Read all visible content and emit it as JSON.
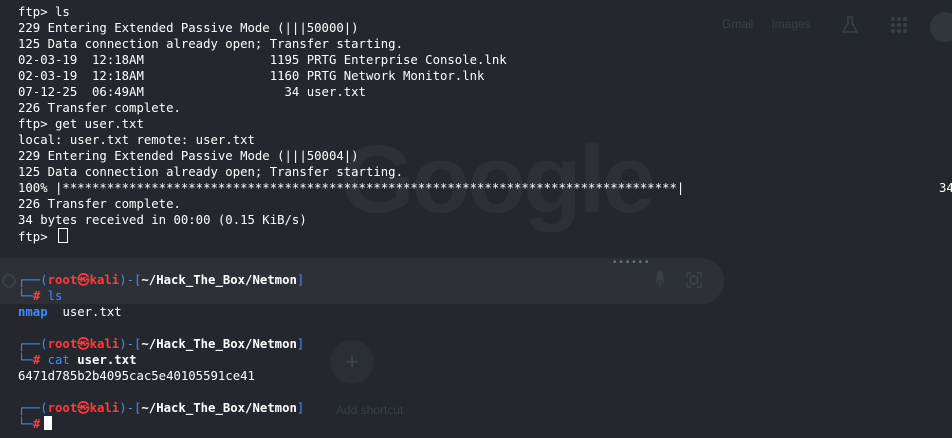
{
  "browser_bg": {
    "links": [
      "Gmail",
      "Images"
    ],
    "logo_text": "Google",
    "shortcut_label": "Add shortcut"
  },
  "ftp": {
    "lines": [
      "ftp> ls",
      "229 Entering Extended Passive Mode (|||50000|)",
      "125 Data connection already open; Transfer starting.",
      "02-03-19  12:18AM                 1195 PRTG Enterprise Console.lnk",
      "02-03-19  12:18AM                 1160 PRTG Network Monitor.lnk",
      "07-12-25  06:49AM                   34 user.txt",
      "226 Transfer complete.",
      "ftp> get user.txt",
      "local: user.txt remote: user.txt",
      "229 Entering Extended Passive Mode (|||50004|)",
      "125 Data connection already open; Transfer starting.",
      "100% |***********************************************************************************|",
      "226 Transfer complete.",
      "34 bytes received in 00:00 (0.15 KiB/s)",
      "ftp> "
    ],
    "progress_tail": "34"
  },
  "prompt": {
    "open": "┌──(",
    "user": "root",
    "skull": "㉿",
    "host": "kali",
    "mid": ")-[",
    "path": "~/Hack_The_Box/Netmon",
    "close": "]",
    "lower": "└─",
    "hash": "#"
  },
  "session": [
    {
      "command": "ls",
      "command_rest": "",
      "output_dir": "nmap",
      "output_file": "user.txt"
    },
    {
      "command": "cat",
      "command_rest": "user.txt",
      "output_text": "6471d785b2b4095cac5e40105591ce41"
    },
    {
      "command": ""
    }
  ],
  "colors": {
    "background": "#24272e",
    "prompt_red": "#ff3b3b",
    "prompt_blue": "#3f8cff",
    "text": "#ffffff"
  }
}
